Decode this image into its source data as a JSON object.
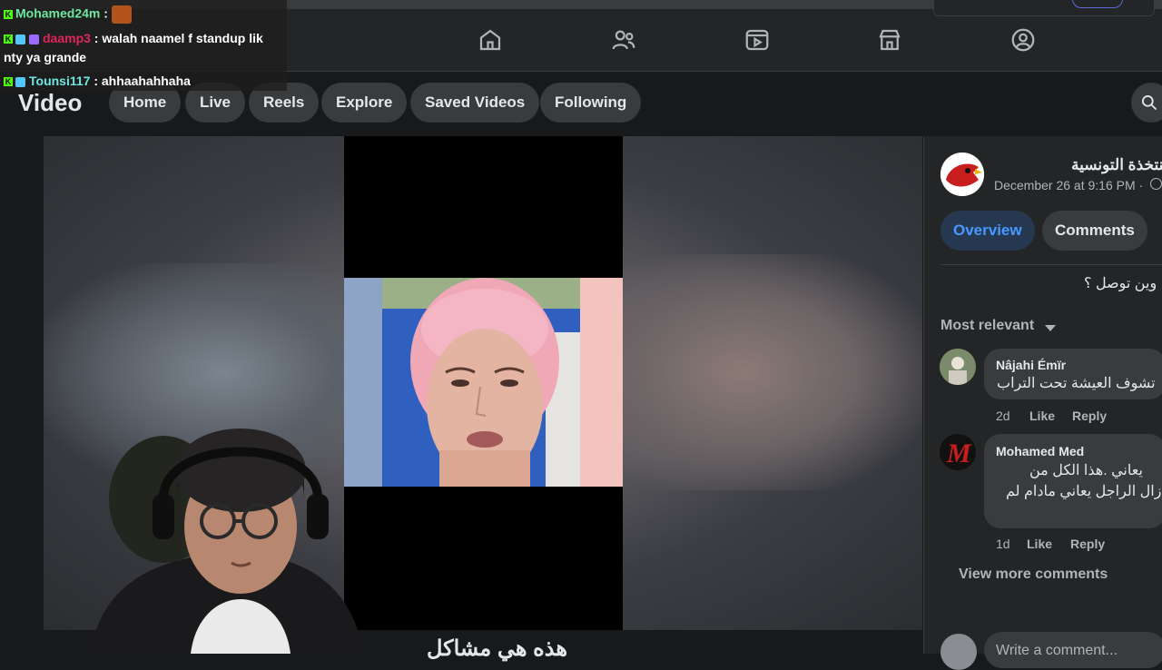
{
  "colors": {
    "accent": "#4599ff",
    "bg": "#18191a",
    "surface": "#242526",
    "kick_green": "#53fc18"
  },
  "topbar": {
    "icons": [
      "home-icon",
      "friends-icon",
      "video-icon",
      "marketplace-icon",
      "groups-icon"
    ]
  },
  "video_header": {
    "title": "Video",
    "tabs": [
      "Home",
      "Live",
      "Reels",
      "Explore",
      "Saved Videos",
      "Following"
    ]
  },
  "video": {
    "caption": "هذه هي مشاكل"
  },
  "post": {
    "page_name": "المنتخذة التونسية",
    "date": "December 26 at 9:16 PM ·",
    "tabs": {
      "overview": "Overview",
      "comments": "Comments"
    },
    "text": "وين توصل ؟",
    "sort_label": "Most relevant",
    "comments": [
      {
        "author": "Nâjahi Émïr",
        "text": "تشوف العيشة تحت التراب",
        "time": "2d",
        "like": "Like",
        "reply": "Reply"
      },
      {
        "author": "Mohamed Med",
        "text_line1": "يعاني .هذا الكل من",
        "text_line2": "زال الراجل يعاني مادام لم",
        "time": "1d",
        "like": "Like",
        "reply": "Reply"
      }
    ],
    "view_more": "View more comments",
    "write_placeholder": "Write a comment..."
  },
  "chat": {
    "messages": [
      {
        "user": "Mohamed24m",
        "sep": " :",
        "text": ""
      },
      {
        "user": "daamp3",
        "sep": " : ",
        "text": "walah naamel f standup lik",
        "cont": "nty ya grande"
      },
      {
        "user": "Tounsi117",
        "sep": " : ",
        "text": "ahhaahahhaha"
      }
    ],
    "user_colors": [
      "#6ee7a0",
      "#e0245e",
      "#6ee7e0"
    ]
  }
}
